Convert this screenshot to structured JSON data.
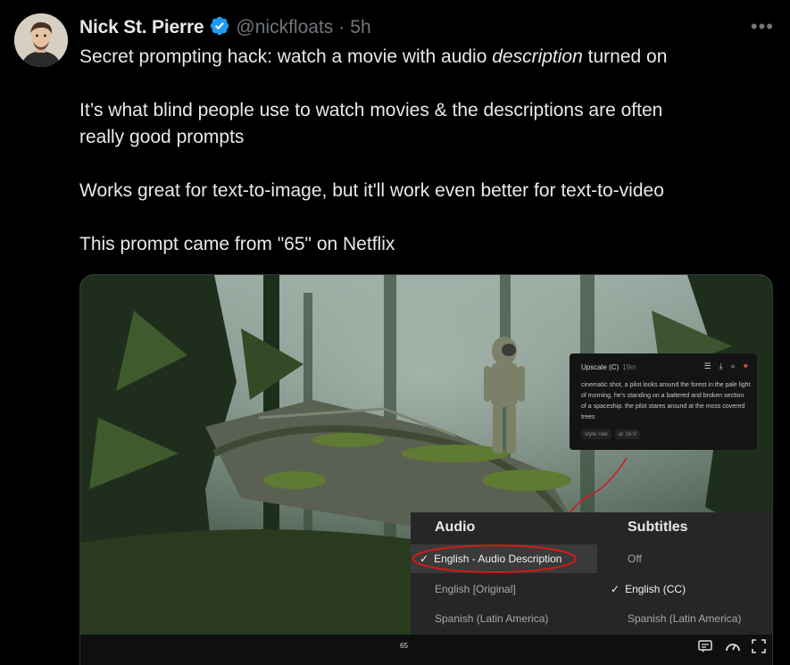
{
  "author": {
    "name": "Nick St. Pierre",
    "handle": "@nickfloats",
    "separator": "·",
    "time": "5h"
  },
  "more_label": "•••",
  "tweet": {
    "line1_before": "Secret prompting hack: watch a movie with audio ",
    "line1_italic": "description",
    "line1_after": " turned on",
    "line2a": "It’s what blind people use to watch movies & the descriptions are often",
    "line2b": "really good prompts",
    "line3": "Works great for text-to-image, but it'll work even better for text-to-video",
    "line4": "This prompt came from \"65\" on Netflix"
  },
  "midjourney_panel": {
    "title": "Upscale (C)",
    "time": "19m",
    "description": "cinematic shot, a pilot looks around the forest in the pale light of morning. he's standing on a battered and broken section of a spaceship. the pilot stares around at the moss covered trees",
    "tags": [
      "style raw",
      "ar 16:9"
    ]
  },
  "player_menu": {
    "audio_header": "Audio",
    "subtitles_header": "Subtitles",
    "audio_options": [
      "English - Audio Description",
      "English [Original]",
      "Spanish (Latin America)"
    ],
    "subtitle_options": [
      "Off",
      "English (CC)",
      "Spanish (Latin America)"
    ],
    "selected_audio": "English - Audio Description",
    "selected_subtitle": "English (CC)"
  },
  "player_bar": {
    "title": "65"
  },
  "colors": {
    "background": "#000000",
    "verified_badge": "#1d9bf0",
    "annotation_red": "#d11a1a",
    "muted_text": "#71767b"
  }
}
